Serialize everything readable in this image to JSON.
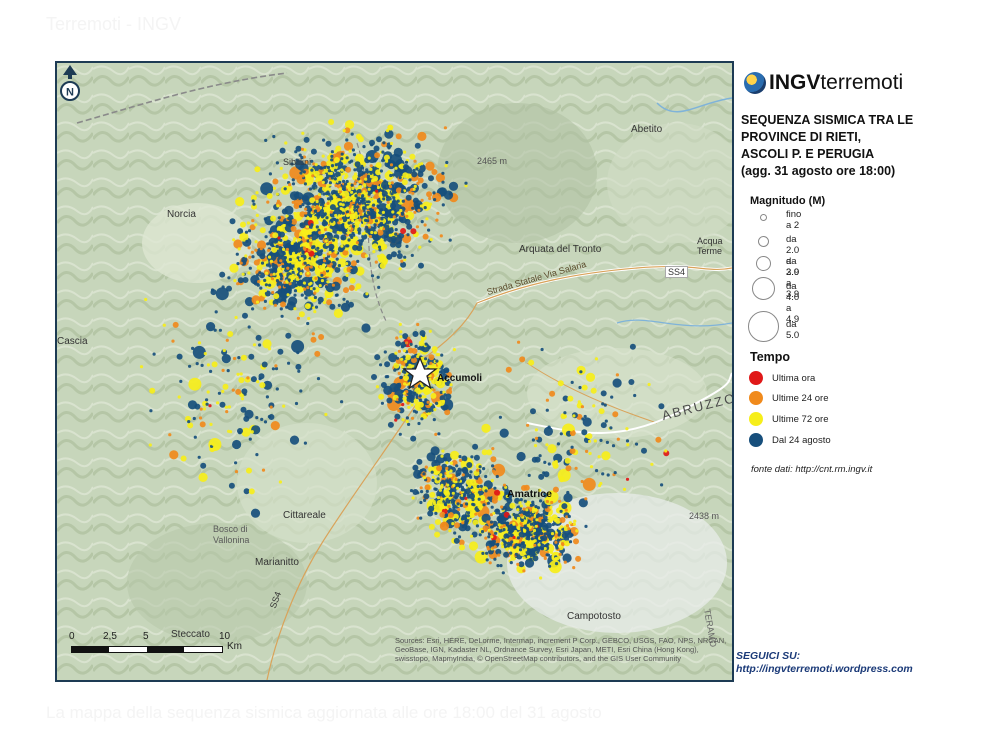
{
  "page": {
    "top_caption": "Terremoti - INGV",
    "bottom_caption": "La mappa della sequenza sismica aggiornata alle ore 18:00 del 31 agosto"
  },
  "map": {
    "north_label": "N",
    "scale": {
      "ticks": [
        "0",
        "2,5",
        "5",
        "10"
      ],
      "unit": "Km"
    },
    "credits": "Sources: Esri, HERE, DeLorme, Intermap, increment P Corp., GEBCO, USGS, FAO, NPS, NRCAN, GeoBase, IGN, Kadaster NL, Ordnance Survey, Esri Japan, METI, Esri China (Hong Kong), swisstopo, MapmyIndia, © OpenStreetMap contributors, and the GIS User Community",
    "places": {
      "norcia": "Norcia",
      "visso": "Sibillini",
      "abetito": "Abetito",
      "arquata": "Arquata del Tronto",
      "acquasanta": "Acqua Terme",
      "salaria": "Strada Statale Via Salaria",
      "ss4": "SS4",
      "ss4b": "SS4",
      "cascia": "Cascia",
      "accumoli": "Accumoli",
      "amatrice": "Amatrice",
      "cittareale": "Cittareale",
      "bosco": "Bosco di Vallonina",
      "marianitto": "Marianitto",
      "steccato": "Steccato",
      "campotosto": "Campotosto",
      "abruzzo": "ABRUZZO",
      "peak1": "2465 m",
      "peak2": "2438 m",
      "teramo": "TERAMO"
    }
  },
  "legend": {
    "logo_bold": "INGV",
    "logo_text": "terremoti",
    "title_lines": [
      "SEQUENZA SISMICA TRA LE",
      "PROVINCE DI RIETI,",
      "ASCOLI P. E PERUGIA",
      "(agg. 31 agosto ore 18:00)"
    ],
    "magnitude_heading": "Magnitudo (M)",
    "magnitude_items": [
      "fino a 2",
      "da 2.0 a 2.9",
      "da 3.0 a 3.9",
      "da 4.0 a 4.9",
      "da 5.0"
    ],
    "time_heading": "Tempo",
    "time_items": [
      {
        "label": "Ultima ora",
        "color": "#e01818"
      },
      {
        "label": "Ultime 24 ore",
        "color": "#f08a1c"
      },
      {
        "label": "Ultime 72 ore",
        "color": "#f6ee1a"
      },
      {
        "label": "Dal 24 agosto",
        "color": "#174f7c"
      }
    ],
    "source": "fonte dati: http://cnt.rm.ingv.it",
    "follow_label": "SEGUICI SU:",
    "follow_url": "http://ingvterremoti.wordpress.com"
  },
  "colors": {
    "blue": "#174f7c",
    "orange": "#f08a1c",
    "yellow": "#f6ee1a",
    "red": "#e01818"
  }
}
